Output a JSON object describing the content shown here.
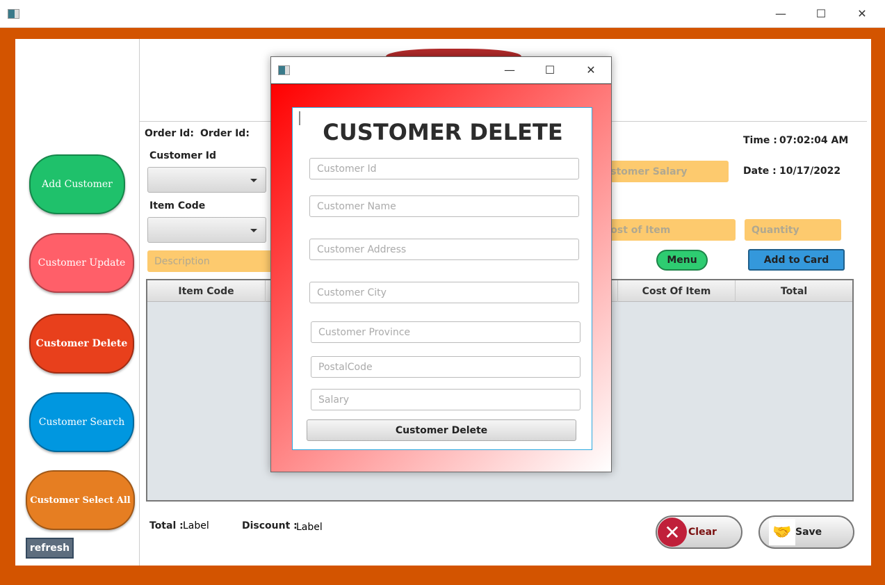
{
  "window": {
    "minimize": "—",
    "maximize": "☐",
    "close": "✕"
  },
  "sidebar": {
    "items": [
      {
        "label": "Add Customer",
        "color": "#1fc16b"
      },
      {
        "label": "Customer Update",
        "color": "#ff5f69"
      },
      {
        "label": "Customer Delete",
        "color": "#e8401c"
      },
      {
        "label": "Customer Search",
        "color": "#0097e0"
      },
      {
        "label": "Customer Select All",
        "color": "#e67e22"
      }
    ],
    "refresh": "refresh"
  },
  "form": {
    "order_id_label": "Order Id:",
    "order_id_value": "Order Id:",
    "customer_id_label": "Customer Id",
    "item_code_label": "Item Code",
    "description_placeholder": "Description",
    "customer_salary_placeholder": "Customer Salary",
    "cost_of_item_placeholder": "Cost of Item",
    "quantity_placeholder": "Quantity",
    "menu": "Menu",
    "add_to_card": "Add  to Card",
    "time_label": "Time :",
    "time_value": "07:02:04 AM",
    "date_label": "Date :",
    "date_value": "10/17/2022"
  },
  "table": {
    "columns": [
      "Item Code",
      "Cost Of Item",
      "Total"
    ]
  },
  "footer": {
    "total_label": "Total :",
    "total_value": "Label",
    "discount_label": "Discount :",
    "discount_value": "Label",
    "clear": "Clear",
    "save": "Save"
  },
  "dialog": {
    "title": "CUSTOMER DELETE",
    "fields": [
      "Customer Id",
      "Customer Name",
      "Customer Address",
      "Customer City",
      "Customer Province",
      "PostalCode",
      "Salary"
    ],
    "button": "Customer Delete",
    "minimize": "—",
    "maximize": "☐",
    "close": "✕"
  }
}
